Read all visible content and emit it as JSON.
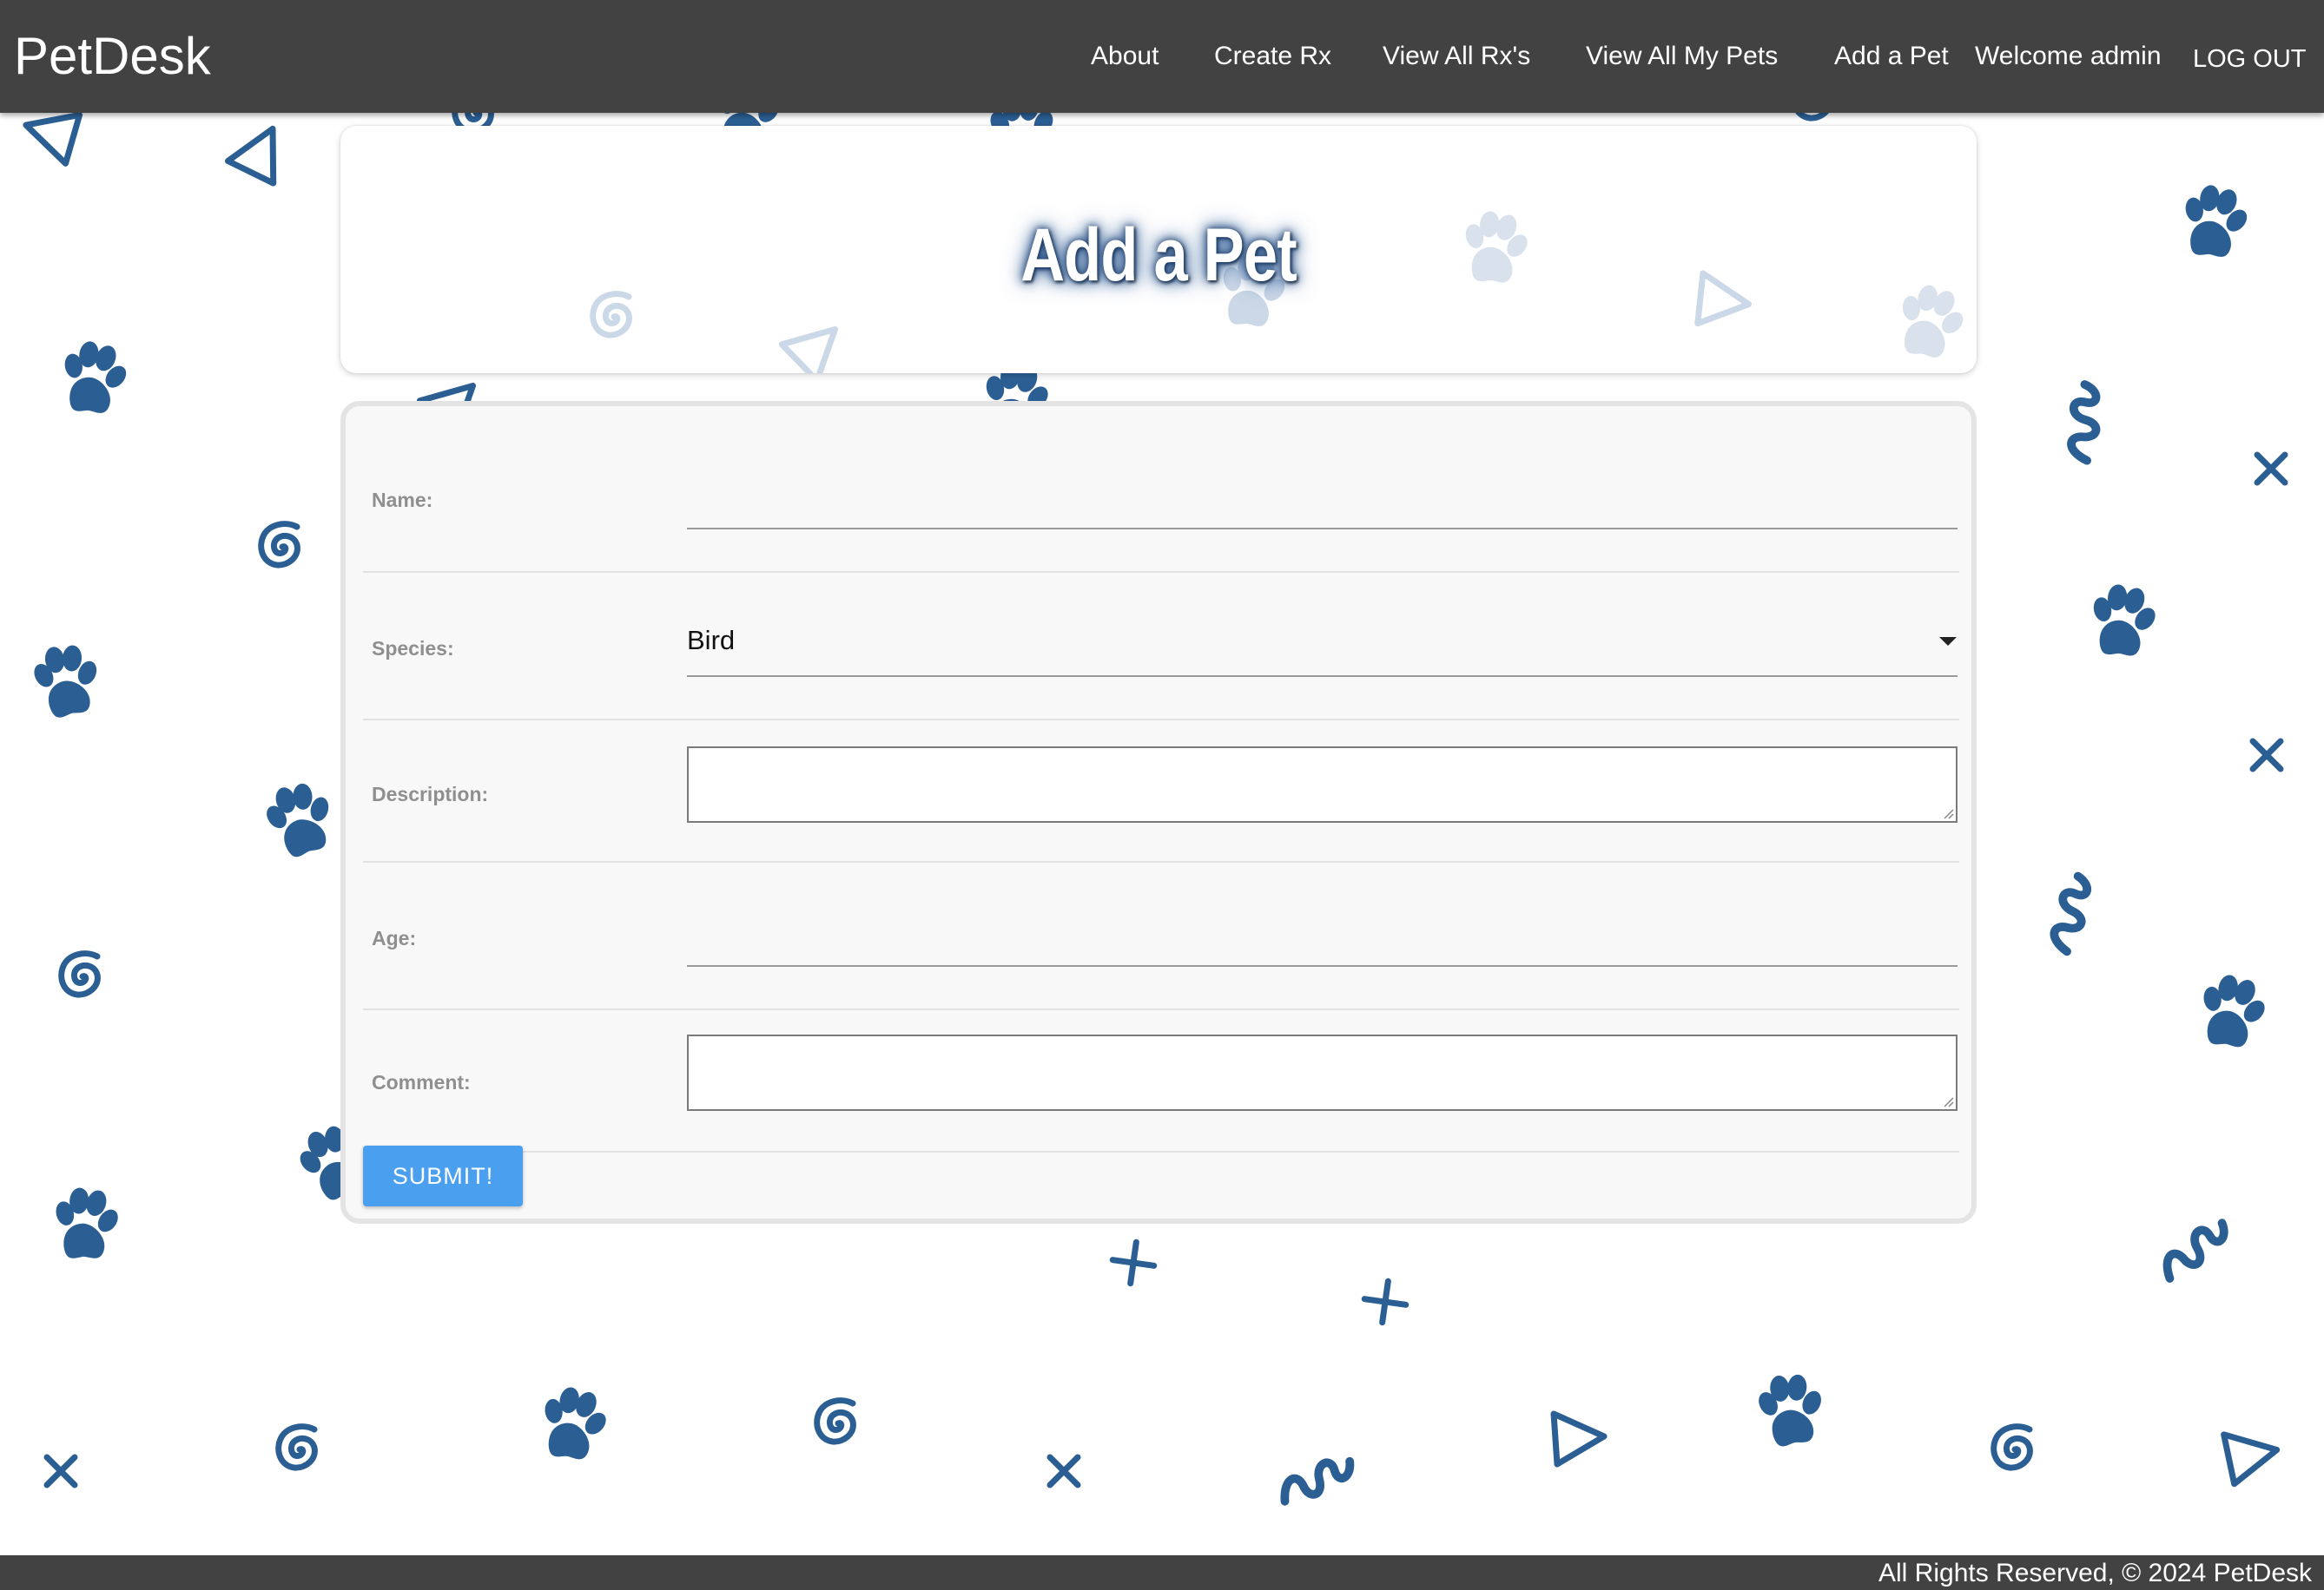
{
  "navbar": {
    "brand": "PetDesk",
    "links": {
      "about": "About",
      "create_rx": "Create Rx",
      "view_all_rx": "View All Rx's",
      "view_all_pets": "View All My Pets",
      "add_pet": "Add a Pet"
    },
    "welcome": "Welcome admin",
    "logout": "LOG OUT"
  },
  "header": {
    "title": "Add a Pet"
  },
  "form": {
    "name_label": "Name:",
    "name_value": "",
    "species_label": "Species:",
    "species_value": "Bird",
    "description_label": "Description:",
    "description_value": "",
    "age_label": "Age:",
    "age_value": "",
    "comment_label": "Comment:",
    "comment_value": "",
    "submit_label": "SUBMIT!"
  },
  "footer": {
    "text": "All Rights Reserved, © 2024 PetDesk"
  },
  "colors": {
    "navbar_bg": "#424242",
    "accent_button": "#4a9fef",
    "decoration_blue": "#2b5f94",
    "watermark_blue": "#c9d7e6"
  },
  "icons": {
    "background": [
      "paw-icon",
      "spiral-icon",
      "triangle-icon",
      "x-icon",
      "plus-icon",
      "squiggle-icon"
    ],
    "select": "caret-down-icon",
    "textarea": "resize-grip-icon"
  }
}
